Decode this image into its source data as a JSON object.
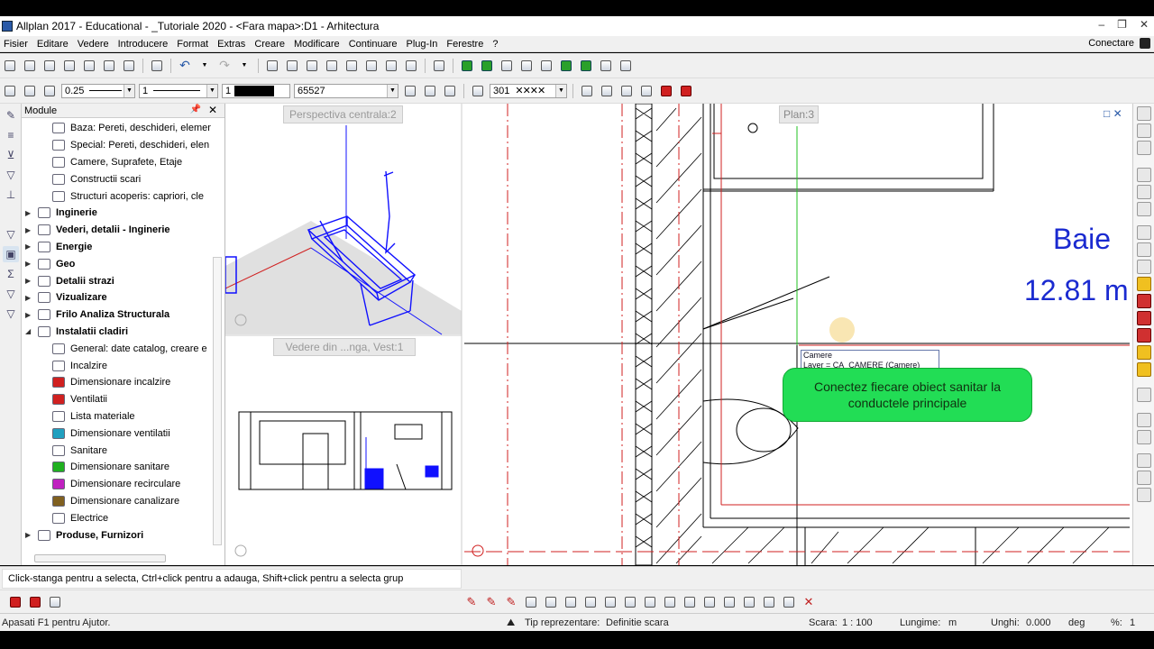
{
  "titlebar": {
    "title": "Allplan 2017 - Educational - _Tutoriale 2020 - <Fara mapa>:D1 - Arhitectura"
  },
  "menu": {
    "items": [
      "Fisier",
      "Editare",
      "Vedere",
      "Introducere",
      "Format",
      "Extras",
      "Creare",
      "Modificare",
      "Continuare",
      "Plug-In",
      "Ferestre",
      "?"
    ],
    "connect_label": "Conectare"
  },
  "format_toolbar": {
    "pen_value": "0.25",
    "line_value": "1",
    "color_value": "1",
    "layer_value": "65527",
    "pattern_value": "301"
  },
  "module_panel": {
    "title": "Module",
    "items": [
      {
        "label": "Baza: Pereti, deschideri, elemen",
        "level": "child"
      },
      {
        "label": "Special: Pereti, deschideri, elen",
        "level": "child"
      },
      {
        "label": "Camere, Suprafete, Etaje",
        "level": "child"
      },
      {
        "label": "Constructii scari",
        "level": "child"
      },
      {
        "label": "Structuri acoperis: capriori, cle",
        "level": "child"
      },
      {
        "label": "Inginerie",
        "level": "top",
        "state": "collapsed"
      },
      {
        "label": "Vederi, detalii - Inginerie",
        "level": "top",
        "state": "collapsed"
      },
      {
        "label": "Energie",
        "level": "top",
        "state": "collapsed"
      },
      {
        "label": "Geo",
        "level": "top",
        "state": "collapsed"
      },
      {
        "label": "Detalii strazi",
        "level": "top",
        "state": "collapsed"
      },
      {
        "label": "Vizualizare",
        "level": "top",
        "state": "collapsed"
      },
      {
        "label": "Frilo Analiza Structurala",
        "level": "top",
        "state": "collapsed"
      },
      {
        "label": "Instalatii cladiri",
        "level": "top",
        "state": "expanded"
      },
      {
        "label": "General: date catalog, creare e",
        "level": "child"
      },
      {
        "label": "Incalzire",
        "level": "child"
      },
      {
        "label": "Dimensionare incalzire",
        "level": "child",
        "color": "#d02020"
      },
      {
        "label": "Ventilatii",
        "level": "child",
        "color": "#d02020"
      },
      {
        "label": "Lista materiale",
        "level": "child"
      },
      {
        "label": "Dimensionare ventilatii",
        "level": "child",
        "color": "#20a0c0"
      },
      {
        "label": "Sanitare",
        "level": "child"
      },
      {
        "label": "Dimensionare sanitare",
        "level": "child",
        "color": "#20b020"
      },
      {
        "label": "Dimensionare recirculare",
        "level": "child",
        "color": "#c020c0"
      },
      {
        "label": "Dimensionare canalizare",
        "level": "child",
        "color": "#806020"
      },
      {
        "label": "Electrice",
        "level": "child"
      },
      {
        "label": "Produse, Furnizori",
        "level": "top",
        "state": "collapsed"
      }
    ]
  },
  "viewports": {
    "perspective_label": "Perspectiva centrala:2",
    "elevation_label": "Vedere din ...nga, Vest:1",
    "plan_label": "Plan:3"
  },
  "room": {
    "name": "Baie",
    "area": "12.81 m",
    "tag_line1": "Camere",
    "tag_line2": "Layer     = CA_CAMERE (Camere)"
  },
  "annotation": {
    "line1": "Conectez fiecare obiect sanitar la",
    "line2": "conductele principale"
  },
  "prompt": {
    "text": "Click-stanga pentru a selecta, Ctrl+click pentru a adauga, Shift+click pentru a selecta grup"
  },
  "statusbar": {
    "help": "Apasati F1 pentru Ajutor.",
    "repr_label": "Tip reprezentare:",
    "repr_value": "Definitie scara",
    "scale_label": "Scara:",
    "scale_value": "1 : 100",
    "length_label": "Lungime:",
    "length_value": "m",
    "angle_label": "Unghi:",
    "angle_value": "0.000",
    "angle_unit": "deg",
    "percent_label": "%:",
    "percent_value": "1"
  },
  "colors": {
    "plan_red": "#d02020",
    "plan_blue": "#1a2ad0",
    "bubble_green": "#22dd55",
    "model_blue": "#1010ff"
  }
}
